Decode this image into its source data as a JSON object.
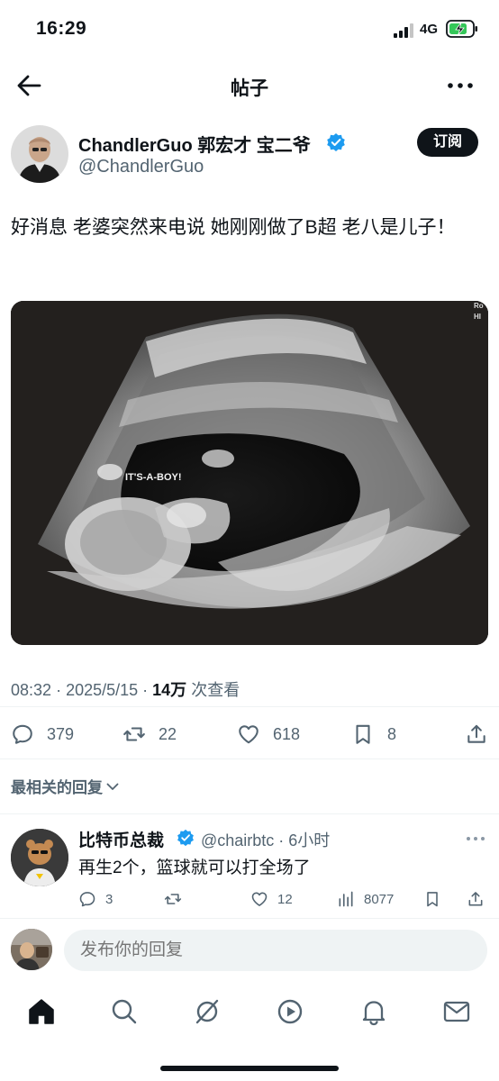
{
  "status_bar": {
    "time": "16:29",
    "network": "4G"
  },
  "nav": {
    "title": "帖子"
  },
  "author": {
    "display_name": "ChandlerGuo 郭宏才 宝二爷",
    "handle": "@ChandlerGuo",
    "subscribe_label": "订阅"
  },
  "post": {
    "text": "好消息 老婆突然来电说 她刚刚做了B超 老八是儿子！",
    "image_overlay_text": "IT'S-A-BOY!",
    "image_corner_text": [
      "Ro",
      "HI"
    ],
    "time": "08:32",
    "date": "2025/5/15",
    "views_count": "14万",
    "views_label": "次查看"
  },
  "actions": {
    "replies": "379",
    "reposts": "22",
    "likes": "618",
    "bookmarks": "8"
  },
  "sort": {
    "label": "最相关的回复"
  },
  "reply": {
    "name": "比特币总裁",
    "handle_time": "@chairbtc · 6小时",
    "text": "再生2个，篮球就可以打全场了",
    "replies": "3",
    "reposts": "",
    "likes": "12",
    "views": "8077"
  },
  "composer": {
    "placeholder": "发布你的回复"
  },
  "icons": {
    "back": "arrow-left-icon",
    "more": "more-horizontal-icon",
    "verified": "verified-badge-icon",
    "reply": "reply-icon",
    "repost": "repost-icon",
    "like": "heart-icon",
    "bookmark": "bookmark-icon",
    "share": "share-icon",
    "views": "views-chart-icon",
    "tabs": [
      "home-icon",
      "search-icon",
      "grok-icon",
      "video-icon",
      "notifications-icon",
      "messages-icon"
    ]
  },
  "colors": {
    "text": "#0f1419",
    "secondary": "#536471",
    "verified": "#1d9bf0",
    "button_bg": "#0f1419",
    "input_bg": "#eff3f4"
  }
}
